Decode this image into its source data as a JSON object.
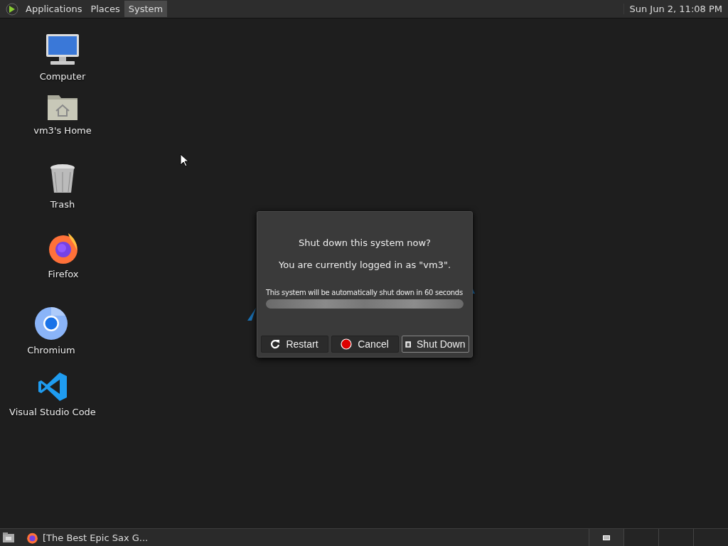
{
  "top_panel": {
    "menus": [
      {
        "label": "Applications",
        "selected": false
      },
      {
        "label": "Places",
        "selected": false
      },
      {
        "label": "System",
        "selected": true
      }
    ],
    "clock": "Sun Jun  2, 11:08 PM"
  },
  "desktop_icons": [
    {
      "kind": "computer",
      "label": "Computer"
    },
    {
      "kind": "home",
      "label": "vm3's Home"
    },
    {
      "kind": "trash",
      "label": "Trash"
    },
    {
      "kind": "firefox",
      "label": "Firefox"
    },
    {
      "kind": "chromium",
      "label": "Chromium"
    },
    {
      "kind": "vscode",
      "label": "Visual Studio Code"
    }
  ],
  "dialog": {
    "question": "Shut down this system now?",
    "user_line": "You are currently logged in as \"vm3\".",
    "countdown": "This system will be automatically shut down in 60 seconds",
    "progress": {
      "level": 1
    },
    "buttons": [
      {
        "kind": "restart",
        "label": "Restart",
        "selected": false
      },
      {
        "kind": "cancel",
        "label": "Cancel",
        "selected": false
      },
      {
        "kind": "shutdown",
        "label": "Shut Down",
        "selected": true
      }
    ]
  },
  "taskbar": {
    "windows": [
      {
        "label": "[The Best Epic Sax G...",
        "selected": false
      }
    ],
    "workspaces": [
      {
        "selected": true
      },
      {
        "selected": false
      },
      {
        "selected": false
      },
      {
        "selected": false
      }
    ]
  }
}
